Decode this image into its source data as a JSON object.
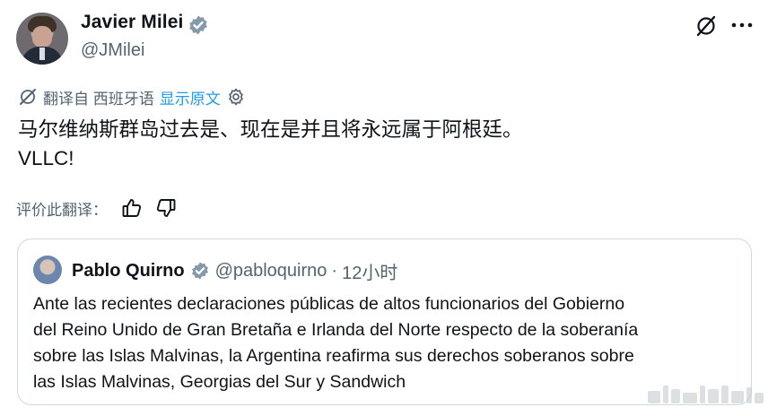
{
  "author": {
    "name": "Javier Milei",
    "handle": "@JMilei"
  },
  "translation": {
    "label": "翻译自 西班牙语",
    "show_original": "显示原文"
  },
  "tweet": {
    "line1": "马尔维纳斯群岛过去是、现在是并且将永远属于阿根廷。",
    "line2": "VLLC!"
  },
  "rating": {
    "label": "评价此翻译："
  },
  "quote": {
    "name": "Pablo Quirno",
    "handle": "@pabloquirno",
    "separator": "·",
    "time": "12小时",
    "lines": [
      "Ante las recientes declaraciones públicas de altos funcionarios del Gobierno",
      "del Reino Unido de Gran Bretaña e Irlanda del Norte respecto de la soberanía",
      "sobre las Islas Malvinas, la Argentina reafirma sus derechos soberanos sobre",
      "las Islas Malvinas, Georgias del Sur y Sandwich"
    ]
  },
  "colors": {
    "verified": "#829aab",
    "link": "#1d9bf0",
    "muted": "#536471"
  },
  "icons": [
    "verified-badge-icon",
    "grok-icon",
    "more-icon",
    "translate-icon",
    "settings-icon",
    "thumbs-up-icon",
    "thumbs-down-icon"
  ]
}
